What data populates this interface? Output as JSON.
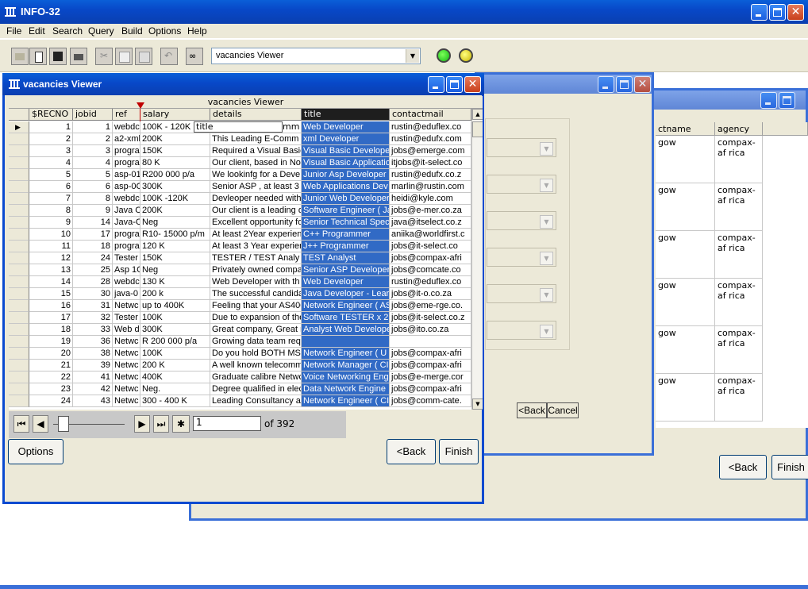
{
  "app": {
    "title": "INFO-32"
  },
  "menu": [
    "File",
    "Edit",
    "Search",
    "Query",
    "Build",
    "Options",
    "Help"
  ],
  "toolbar": {
    "view_combo": "vacancies Viewer"
  },
  "viewer": {
    "title": "vacancies Viewer",
    "caption": "vacancies Viewer",
    "columns": [
      "$RECNO",
      "jobid",
      "ref",
      "salary",
      "details",
      "title",
      "contactmail"
    ],
    "edit_overlay": {
      "text": "title",
      "trailing": "mm c"
    },
    "rows": [
      {
        "recno": "1",
        "jobid": "1",
        "ref": "webdc",
        "salary": "100K - 120K",
        "details": "",
        "title": "Web Developer",
        "contactmail": "rustin@eduflex.co"
      },
      {
        "recno": "2",
        "jobid": "2",
        "ref": "a2-xml",
        "salary": "200K",
        "details": "This Leading E-Comm c",
        "title": "xml Developer",
        "contactmail": "rustin@edufx.com"
      },
      {
        "recno": "3",
        "jobid": "3",
        "ref": "progra",
        "salary": "150K",
        "details": "Required a Visual Basic",
        "title": "Visual Basic Develope",
        "contactmail": "jobs@emerge.com"
      },
      {
        "recno": "4",
        "jobid": "4",
        "ref": "progra",
        "salary": "80 K",
        "details": "Our client, based in Nor",
        "title": "Visual Basic Applicatio",
        "contactmail": "itjobs@it-select.co"
      },
      {
        "recno": "5",
        "jobid": "5",
        "ref": "asp-01",
        "salary": "R200 000 p/a",
        "details": "We lookinfg for a Deve",
        "title": "Junior Asp Developer",
        "contactmail": "rustin@edufx.co.z"
      },
      {
        "recno": "6",
        "jobid": "6",
        "ref": "asp-0C",
        "salary": "300K",
        "details": "Senior ASP , at least 3",
        "title": "Web Applications Dev",
        "contactmail": "marlin@rustin.com"
      },
      {
        "recno": "7",
        "jobid": "8",
        "ref": "webdc",
        "salary": "100K -120K",
        "details": "Devleoper needed with",
        "title": "Junior Web Developer",
        "contactmail": "heidi@kyle.com"
      },
      {
        "recno": "8",
        "jobid": "9",
        "ref": "Java C",
        "salary": "200K",
        "details": "Our client is a leading d",
        "title": "Software Engineer ( Ja",
        "contactmail": "jobs@e-mer.co.za"
      },
      {
        "recno": "9",
        "jobid": "14",
        "ref": "Java-C",
        "salary": "Neg",
        "details": "Excellent opportunity fo",
        "title": "Senior Technical Spec",
        "contactmail": "java@itselect.co.z"
      },
      {
        "recno": "10",
        "jobid": "17",
        "ref": "progra",
        "salary": "R10- 15000 p/m",
        "details": "At least 2Year experien",
        "title": "C++ Programmer",
        "contactmail": "aniika@worldfirst.c"
      },
      {
        "recno": "11",
        "jobid": "18",
        "ref": "progra",
        "salary": "120 K",
        "details": "At least 3 Year experier",
        "title": "J++ Programmer",
        "contactmail": "jobs@it-select.co"
      },
      {
        "recno": "12",
        "jobid": "24",
        "ref": "Tester",
        "salary": "150K",
        "details": "TESTER / TEST Analy",
        "title": "TEST Analyst",
        "contactmail": "jobs@compax-afri"
      },
      {
        "recno": "13",
        "jobid": "25",
        "ref": "Asp 1C",
        "salary": "Neg",
        "details": "Privately owned compa",
        "title": "Senior ASP Developer",
        "contactmail": "jobs@comcate.co"
      },
      {
        "recno": "14",
        "jobid": "28",
        "ref": "webdc",
        "salary": "130 K",
        "details": "Web Developer with th",
        "title": "Web Developer",
        "contactmail": "rustin@eduflex.co"
      },
      {
        "recno": "15",
        "jobid": "30",
        "ref": "java-0",
        "salary": "200 k",
        "details": "The successful candida",
        "title": "Java Developer - Lear",
        "contactmail": "jobs@it-o.co.za"
      },
      {
        "recno": "16",
        "jobid": "31",
        "ref": "Netwc",
        "salary": "up to 400K",
        "details": "Feeling that your AS400",
        "title": "Network Engineer ( AS",
        "contactmail": "jobs@eme-rge.co."
      },
      {
        "recno": "17",
        "jobid": "32",
        "ref": "Tester",
        "salary": "100K",
        "details": "Due to expansion of the",
        "title": "Software TESTER x 2",
        "contactmail": "jobs@it-select.co.z"
      },
      {
        "recno": "18",
        "jobid": "33",
        "ref": "Web d",
        "salary": "300K",
        "details": "Great company, Great r",
        "title": "Analyst Web Develope",
        "contactmail": "jobs@ito.co.za"
      },
      {
        "recno": "19",
        "jobid": "36",
        "ref": "Netwc",
        "salary": "R 200 000 p/a",
        "details": "Growing data team requ",
        "title": "",
        "contactmail": ""
      },
      {
        "recno": "20",
        "jobid": "38",
        "ref": "Netwc",
        "salary": "100K",
        "details": "Do you hold BOTH MS",
        "title": " Network Engineer ( U",
        "contactmail": "jobs@compax-afri"
      },
      {
        "recno": "21",
        "jobid": "39",
        "ref": "Netwc",
        "salary": "200 K",
        "details": "A well known telecomm",
        "title": "Network Manager ( CI:",
        "contactmail": "jobs@compax-afri"
      },
      {
        "recno": "22",
        "jobid": "41",
        "ref": "Netwc",
        "salary": "400K",
        "details": "Graduate calibre Netwc",
        "title": "Voice Networking Eng",
        "contactmail": "jobs@e-merge.cor"
      },
      {
        "recno": "23",
        "jobid": "42",
        "ref": "Netwc",
        "salary": "Neg.",
        "details": "Degree qualified in elec",
        "title": " Data Network Engine",
        "contactmail": "jobs@compax-afri"
      },
      {
        "recno": "24",
        "jobid": "43",
        "ref": "Netwc",
        "salary": "300 - 400 K",
        "details": "Leading Consultancy ar",
        "title": "Network Engineer ( CI:",
        "contactmail": "jobs@comm-cate."
      }
    ],
    "nav": {
      "record_value": "1",
      "of_label": "of 392"
    },
    "buttons": {
      "options": "Options",
      "back": "<Back",
      "finish": "Finish"
    }
  },
  "wizard": {
    "back": "<Back",
    "cancel": "Cancel"
  },
  "third_window": {
    "columns": [
      "ctname",
      "agency"
    ],
    "rows": [
      {
        "ctname": "gow",
        "agency": "compax-af rica"
      },
      {
        "ctname": "gow",
        "agency": "compax-af rica"
      },
      {
        "ctname": "gow",
        "agency": "compax-af rica"
      },
      {
        "ctname": "gow",
        "agency": "compax-af rica"
      },
      {
        "ctname": "gow",
        "agency": "compax-af rica"
      },
      {
        "ctname": "gow",
        "agency": "compax-af rica"
      }
    ],
    "back": "<Back",
    "finish": "Finish"
  }
}
